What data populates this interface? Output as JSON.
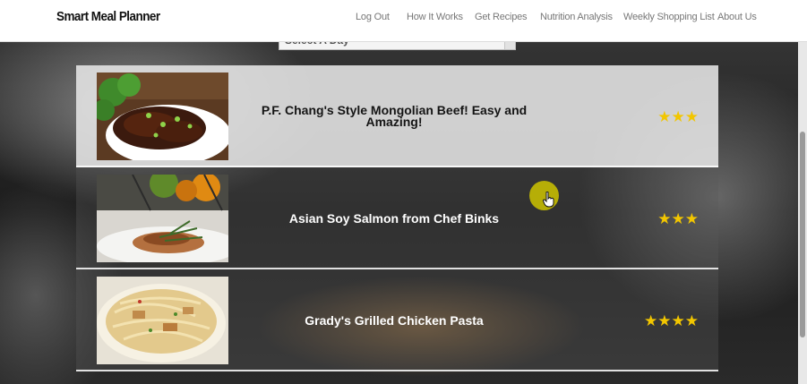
{
  "app": {
    "brand": "Smart Meal Planner"
  },
  "nav": {
    "items": [
      {
        "label": "Log Out"
      },
      {
        "label": "How It Works"
      },
      {
        "label": "Get Recipes"
      },
      {
        "label": "Nutrition Analysis"
      },
      {
        "label": "Weekly Shopping List"
      },
      {
        "label": "About Us"
      }
    ]
  },
  "day_select": {
    "selected": "Select A Day"
  },
  "recipes": [
    {
      "title": "P.F. Chang's Style Mongolian Beef! Easy and Amazing!",
      "rating": 3,
      "image": "mongolian-beef-photo"
    },
    {
      "title": "Asian Soy Salmon from Chef Binks",
      "rating": 3,
      "image": "soy-salmon-photo"
    },
    {
      "title": "Grady's Grilled Chicken Pasta",
      "rating": 4,
      "image": "chicken-pasta-photo"
    }
  ],
  "colors": {
    "star": "#f2c600",
    "cursor_highlight": "#cec400"
  },
  "icons": {
    "star": "star-icon",
    "cursor": "hand-cursor-icon"
  }
}
